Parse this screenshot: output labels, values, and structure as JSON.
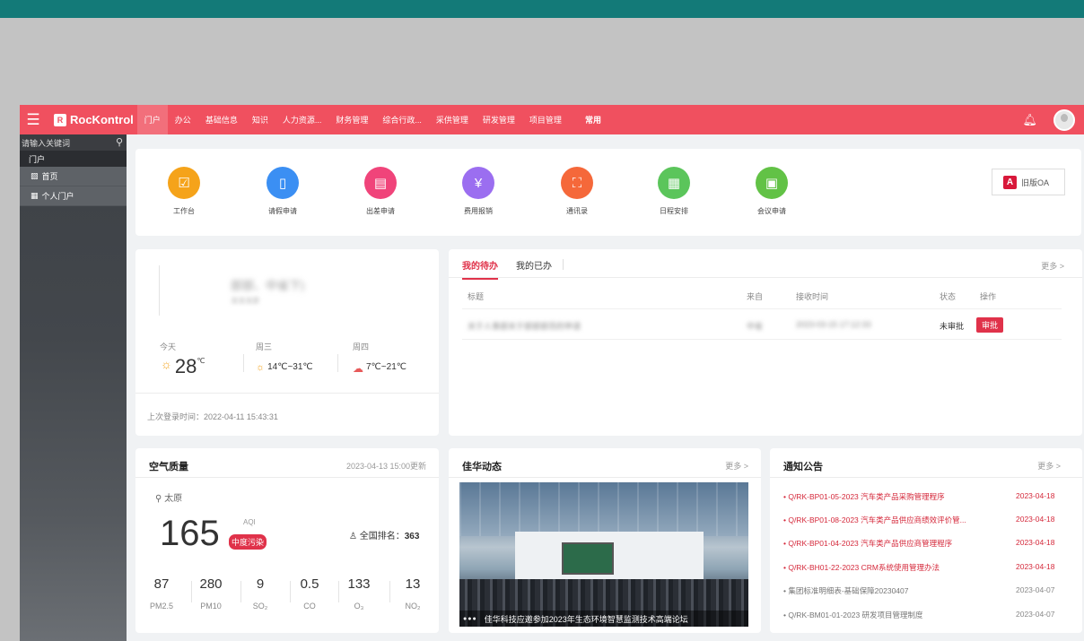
{
  "nav": {
    "brand": "RocKontrol",
    "items": [
      "门户",
      "办公",
      "基础信息",
      "知识",
      "人力资源...",
      "财务管理",
      "综合行政...",
      "采供管理",
      "研发管理",
      "项目管理"
    ],
    "bold_item": "常用"
  },
  "sidebar": {
    "search_placeholder": "请输入关键词",
    "group": "门户",
    "items": [
      {
        "icon": "home-icon",
        "label": "首页"
      },
      {
        "icon": "portal-icon",
        "label": "个人门户"
      }
    ]
  },
  "apps": {
    "items": [
      {
        "label": "工作台",
        "color": "#f5a31a",
        "icon": "checklist-icon"
      },
      {
        "label": "请假申请",
        "color": "#3b8ff3",
        "icon": "leave-icon"
      },
      {
        "label": "出差申请",
        "color": "#f0447a",
        "icon": "travel-icon"
      },
      {
        "label": "费用报销",
        "color": "#9b6ef0",
        "icon": "yen-icon"
      },
      {
        "label": "通讯录",
        "color": "#f5683a",
        "icon": "contacts-icon"
      },
      {
        "label": "日程安排",
        "color": "#5bc55b",
        "icon": "calendar-icon"
      },
      {
        "label": "会议申请",
        "color": "#62c246",
        "icon": "meeting-icon"
      }
    ],
    "old_oa": "旧版OA"
  },
  "profile": {
    "name": "部部、中省下)",
    "subtitle": "法法法部",
    "weather": [
      {
        "day": "今天",
        "temp": "28",
        "unit": "℃",
        "icon": "sun-icon"
      },
      {
        "day": "周三",
        "temp": "14℃~31℃",
        "icon": "sun-icon"
      },
      {
        "day": "周四",
        "temp": "7℃~21℃",
        "icon": "cloud-icon"
      }
    ],
    "last_login": "上次登录时间：2022-04-11 15:43:31"
  },
  "todo": {
    "tabs": [
      "我的待办",
      "我的已办"
    ],
    "more": "更多 >",
    "headers": {
      "title": "标题",
      "from": "来自",
      "time": "接收时间",
      "status": "状态",
      "action": "操作"
    },
    "row": {
      "title": "关于人事部关于部部部员的申请",
      "from": "中省",
      "time": "2023-03-15 17:12:33",
      "status": "未审批",
      "action": "审批"
    }
  },
  "air": {
    "title": "空气质量",
    "updated": "2023-04-13 15:00更新",
    "location": "太原",
    "aqi": "165",
    "aqi_label": "AQI",
    "level": "中度污染",
    "rank_label": "全国排名：",
    "rank": "363",
    "pollutants": [
      {
        "value": "87",
        "name": "PM2.5"
      },
      {
        "value": "280",
        "name": "PM10"
      },
      {
        "value": "9",
        "name": "SO₂"
      },
      {
        "value": "0.5",
        "name": "CO"
      },
      {
        "value": "133",
        "name": "O₃"
      },
      {
        "value": "13",
        "name": "NO₂"
      }
    ]
  },
  "news": {
    "title": "佳华动态",
    "more": "更多 >",
    "caption": "佳华科技应邀参加2023年生态环境智慧监测技术高端论坛"
  },
  "notice": {
    "title": "通知公告",
    "more": "更多 >",
    "items": [
      {
        "text": "• Q/RK-BP01-05-2023 汽车类产品采购管理程序",
        "date": "2023-04-18",
        "style": "red"
      },
      {
        "text": "• Q/RK-BP01-08-2023 汽车类产品供应商绩效评价管...",
        "date": "2023-04-18",
        "style": "red"
      },
      {
        "text": "• Q/RK-BP01-04-2023 汽车类产品供应商管理程序",
        "date": "2023-04-18",
        "style": "red"
      },
      {
        "text": "• Q/RK-BH01-22-2023 CRM系统使用管理办法",
        "date": "2023-04-18",
        "style": "red"
      },
      {
        "text": "• 集团标准明细表-基础保障20230407",
        "date": "2023-04-07",
        "style": "gray"
      },
      {
        "text": "• Q/RK-BM01-01-2023 研发项目管理制度",
        "date": "2023-04-07",
        "style": "gray"
      }
    ]
  }
}
